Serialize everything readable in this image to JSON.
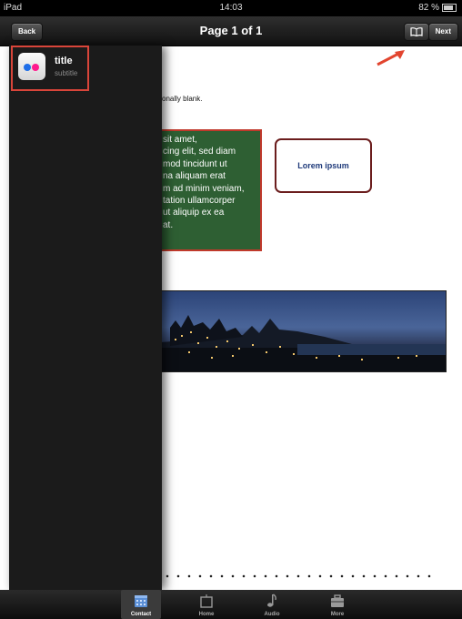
{
  "status": {
    "carrier": "iPad",
    "time": "14:03",
    "battery": "82 %"
  },
  "nav": {
    "back_label": "Back",
    "title": "Page 1 of 1",
    "next_label": "Next"
  },
  "document": {
    "blank_note": "onally blank.",
    "green_text": "sit amet,\ncing elit, sed diam\nmod tincidunt ut\nna aliquam erat\nm ad minim veniam,\ntation ullamcorper\nut aliquip ex ea\nat.",
    "lorem_box": "Lorem ipsum"
  },
  "panel": {
    "item_title": "title",
    "item_subtitle": "subtitle"
  },
  "tabs": [
    {
      "label": "Contact"
    },
    {
      "label": "Home"
    },
    {
      "label": "Audio"
    },
    {
      "label": "More"
    }
  ],
  "colors": {
    "annotation": "#d9453a",
    "green_box": "#2e5f33",
    "lorem_border": "#6b1d1d"
  }
}
